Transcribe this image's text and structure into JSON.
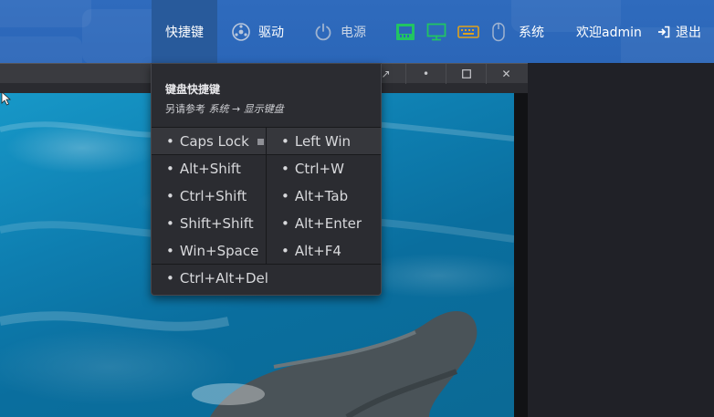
{
  "nav": {
    "shortcuts": "快捷键",
    "drivers": "驱动",
    "power": "电源",
    "system": "系统",
    "welcome": "欢迎admin",
    "logout": "退出"
  },
  "shortcut_menu": {
    "title": "键盘快捷键",
    "hint_prefix": "另请参考 ",
    "hint_system": "系统",
    "hint_arrow": " → ",
    "hint_target": "显示键盘",
    "rows": [
      [
        "Caps Lock",
        "Left Win"
      ],
      [
        "Alt+Shift",
        "Ctrl+W"
      ],
      [
        "Ctrl+Shift",
        "Alt+Tab"
      ],
      [
        "Shift+Shift",
        "Alt+Enter"
      ],
      [
        "Win+Space",
        "Alt+F4"
      ]
    ],
    "full_row": "Ctrl+Alt+Del"
  },
  "colors": {
    "topbar": "#2b66b8",
    "active_tab": "#285a9b",
    "menu_bg": "#2b2c31",
    "status_green": "#21c463",
    "status_yellow": "#e0a21c"
  }
}
